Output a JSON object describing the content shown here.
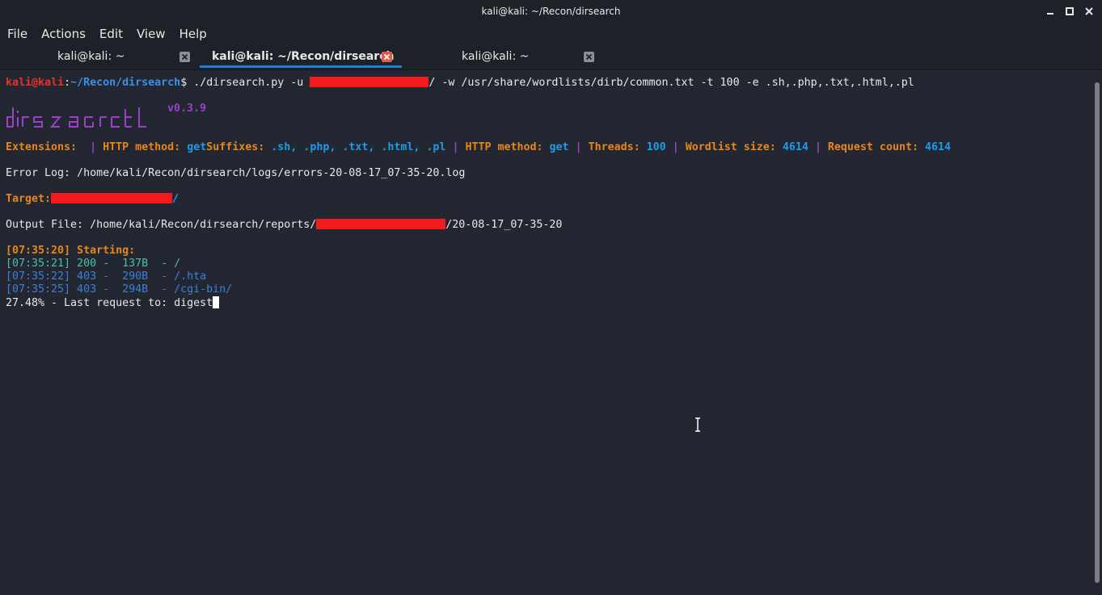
{
  "window": {
    "title": "kali@kali: ~/Recon/dirsearch"
  },
  "menu": {
    "items": [
      "File",
      "Actions",
      "Edit",
      "View",
      "Help"
    ]
  },
  "tabs": [
    {
      "label": "kali@kali: ~",
      "active": false
    },
    {
      "label": "kali@kali: ~/Recon/dirsearch",
      "active": true
    },
    {
      "label": "kali@kali: ~",
      "active": false
    }
  ],
  "terminal": {
    "prompt_user": "kali",
    "prompt_at": "@",
    "prompt_host": "kali",
    "prompt_colon": ":",
    "prompt_path": "~/Recon/dirsearch",
    "prompt_symbol": "$",
    "command_start": " ./dirsearch.py -u ",
    "command_end": "/ -w /usr/share/wordlists/dirb/common.txt -t 100 -e .sh,.php,.txt,.html,.pl",
    "logo_text": "dirsearch",
    "version": "v0.3.9",
    "extensions_label": "Extensions: ",
    "sep1": " | ",
    "http_method_label_1": "HTTP method: ",
    "http_method_value_1": "get",
    "suffixes_label": "Suffixes: ",
    "suffixes_value": ".sh, .php, .txt, .html, .pl",
    "http_method_label_2": "HTTP method: ",
    "http_method_value_2": "get",
    "threads_label": "Threads: ",
    "threads_value": "100",
    "wordlist_label": "Wordlist size: ",
    "wordlist_value": "4614",
    "request_label": "Request count: ",
    "request_value": "4614",
    "error_log": "Error Log: /home/kali/Recon/dirsearch/logs/errors-20-08-17_07-35-20.log",
    "target_label": "Target: ",
    "target_suffix": "/",
    "output_prefix": "Output File: /home/kali/Recon/dirsearch/reports/",
    "output_suffix": "/20-08-17_07-35-20",
    "starting": "[07:35:20] Starting: ",
    "results": [
      {
        "text": "[07:35:21] 200 -  137B  - /",
        "color": "green"
      },
      {
        "text": "[07:35:22] 403 -  290B  - /.hta",
        "color": "blue"
      },
      {
        "text": "[07:35:25] 403 -  294B  - /cgi-bin/",
        "color": "blue"
      }
    ],
    "progress": "27.48% - Last request to: digest"
  },
  "colors": {
    "background": "#232731",
    "prompt_red": "#e8312a",
    "prompt_blue": "#3d8ee8",
    "orange": "#e8861a",
    "cyan": "#1e9be8",
    "purple": "#9b41c8",
    "green": "#4ebfa4",
    "redaction": "#f21b1b",
    "tab_underline": "#1e7cd6"
  }
}
